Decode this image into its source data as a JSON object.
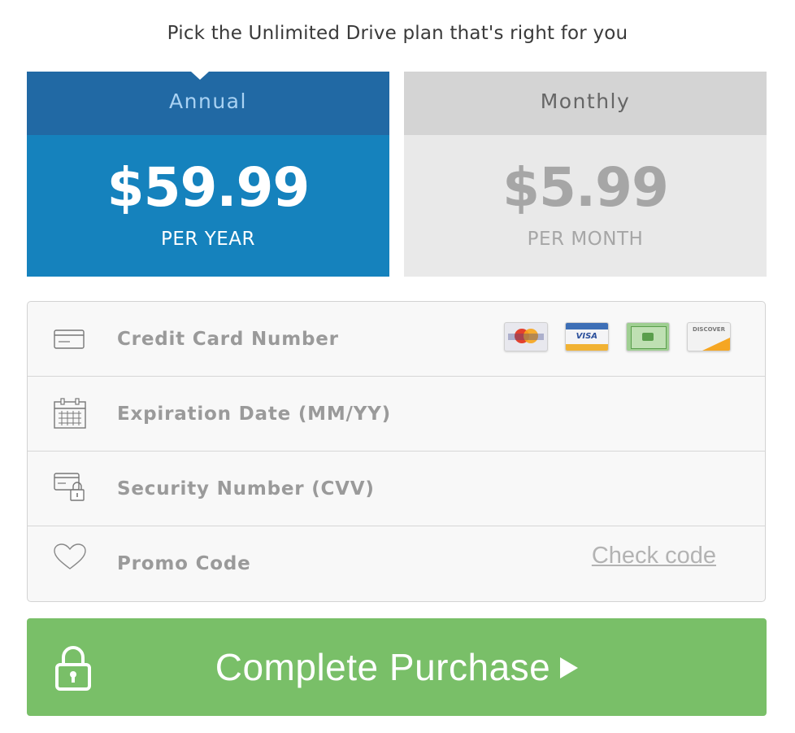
{
  "heading": "Pick the Unlimited Drive plan that's right for you",
  "plans": [
    {
      "name": "Annual",
      "price": "$59.99",
      "period": "PER YEAR",
      "selected": true
    },
    {
      "name": "Monthly",
      "price": "$5.99",
      "period": "PER MONTH",
      "selected": false
    }
  ],
  "form": {
    "card_number": {
      "placeholder": "Credit Card Number",
      "value": "",
      "icon": "credit-card-icon"
    },
    "card_brands": [
      {
        "name": "MasterCard",
        "label": "MasterCard"
      },
      {
        "name": "Visa",
        "label": "VISA"
      },
      {
        "name": "Generic card",
        "label": ""
      },
      {
        "name": "Discover",
        "label": "DISCOVER"
      }
    ],
    "expiration": {
      "placeholder": "Expiration Date (MM/YY)",
      "value": "",
      "icon": "calendar-icon"
    },
    "cvv": {
      "placeholder": "Security Number (CVV)",
      "value": "",
      "icon": "card-lock-icon"
    },
    "promo": {
      "placeholder": "Promo Code",
      "value": "",
      "icon": "heart-icon",
      "check_label": "Check code"
    }
  },
  "cta": {
    "label": "Complete Purchase",
    "icon": "lock-icon"
  },
  "colors": {
    "annual_band": "#2169a4",
    "annual_body": "#1582bd",
    "monthly_band": "#d4d4d4",
    "monthly_body": "#e9e9e9",
    "cta": "#79bf68"
  }
}
